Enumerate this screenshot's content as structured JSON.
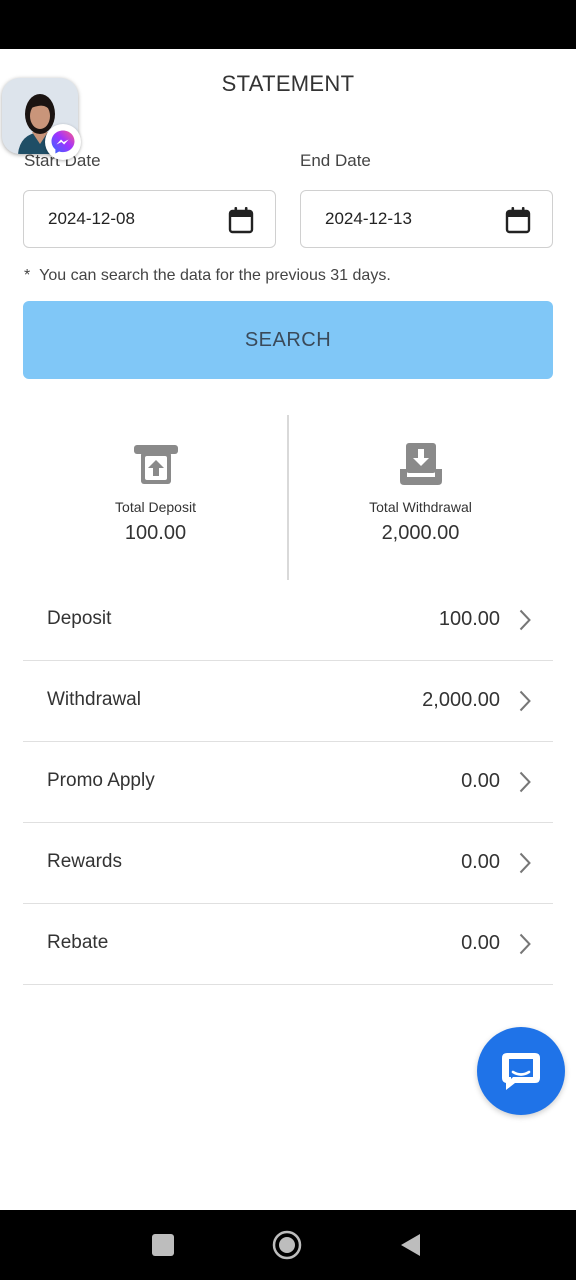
{
  "header": {
    "title": "STATEMENT"
  },
  "form": {
    "start_label": "Start Date",
    "start_value": "2024-12-08",
    "end_label": "End Date",
    "end_value": "2024-12-13",
    "note_marker": "*",
    "note": "You can search the data for the previous 31 days.",
    "search_label": "SEARCH"
  },
  "totals": {
    "deposit": {
      "label": "Total Deposit",
      "value": "100.00",
      "icon": "upload-tray-icon"
    },
    "withdrawal": {
      "label": "Total Withdrawal",
      "value": "2,000.00",
      "icon": "download-tray-icon"
    }
  },
  "rows": [
    {
      "label": "Deposit",
      "value": "100.00"
    },
    {
      "label": "Withdrawal",
      "value": "2,000.00"
    },
    {
      "label": "Promo Apply",
      "value": "0.00"
    },
    {
      "label": "Rewards",
      "value": "0.00"
    },
    {
      "label": "Rebate",
      "value": "0.00"
    }
  ],
  "overlays": {
    "chat_head": "messenger-icon",
    "chat_button": "chat-bubble-icon"
  },
  "colors": {
    "accent": "#80c7f7",
    "fab": "#1f73e8",
    "text": "#333333",
    "divider": "#e0e0e0"
  }
}
